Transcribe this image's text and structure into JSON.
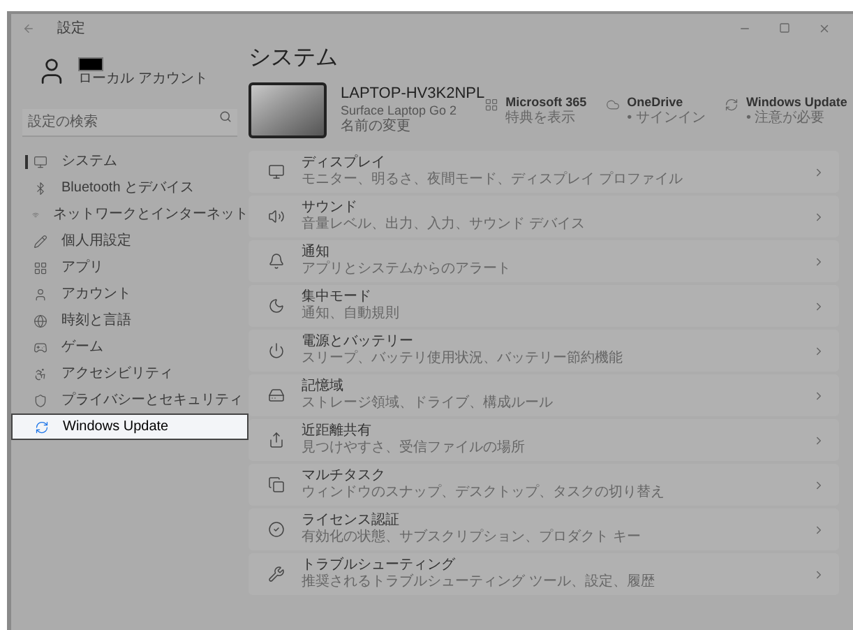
{
  "window": {
    "title": "設定"
  },
  "account": {
    "label": "ローカル アカウント"
  },
  "search": {
    "placeholder": "設定の検索"
  },
  "sidebar": {
    "items": [
      {
        "label": "システム",
        "selected": true,
        "highlighted": false
      },
      {
        "label": "Bluetooth とデバイス",
        "selected": false,
        "highlighted": false
      },
      {
        "label": "ネットワークとインターネット",
        "selected": false,
        "highlighted": false
      },
      {
        "label": "個人用設定",
        "selected": false,
        "highlighted": false
      },
      {
        "label": "アプリ",
        "selected": false,
        "highlighted": false
      },
      {
        "label": "アカウント",
        "selected": false,
        "highlighted": false
      },
      {
        "label": "時刻と言語",
        "selected": false,
        "highlighted": false
      },
      {
        "label": "ゲーム",
        "selected": false,
        "highlighted": false
      },
      {
        "label": "アクセシビリティ",
        "selected": false,
        "highlighted": false
      },
      {
        "label": "プライバシーとセキュリティ",
        "selected": false,
        "highlighted": false
      },
      {
        "label": "Windows Update",
        "selected": false,
        "highlighted": true
      }
    ]
  },
  "page": {
    "title": "システム"
  },
  "device": {
    "name": "LAPTOP-HV3K2NPL",
    "model": "Surface Laptop Go 2",
    "rename": "名前の変更"
  },
  "services": [
    {
      "title": "Microsoft 365",
      "subtitle": "特典を表示"
    },
    {
      "title": "OneDrive",
      "subtitle": "• サインイン"
    },
    {
      "title": "Windows Update",
      "subtitle": "• 注意が必要"
    }
  ],
  "settings": [
    {
      "title": "ディスプレイ",
      "subtitle": "モニター、明るさ、夜間モード、ディスプレイ プロファイル"
    },
    {
      "title": "サウンド",
      "subtitle": "音量レベル、出力、入力、サウンド デバイス"
    },
    {
      "title": "通知",
      "subtitle": "アプリとシステムからのアラート"
    },
    {
      "title": "集中モード",
      "subtitle": "通知、自動規則"
    },
    {
      "title": "電源とバッテリー",
      "subtitle": "スリープ、バッテリ使用状況、バッテリー節約機能"
    },
    {
      "title": "記憶域",
      "subtitle": "ストレージ領域、ドライブ、構成ルール"
    },
    {
      "title": "近距離共有",
      "subtitle": "見つけやすさ、受信ファイルの場所"
    },
    {
      "title": "マルチタスク",
      "subtitle": "ウィンドウのスナップ、デスクトップ、タスクの切り替え"
    },
    {
      "title": "ライセンス認証",
      "subtitle": "有効化の状態、サブスクリプション、プロダクト キー"
    },
    {
      "title": "トラブルシューティング",
      "subtitle": "推奨されるトラブルシューティング ツール、設定、履歴"
    }
  ]
}
